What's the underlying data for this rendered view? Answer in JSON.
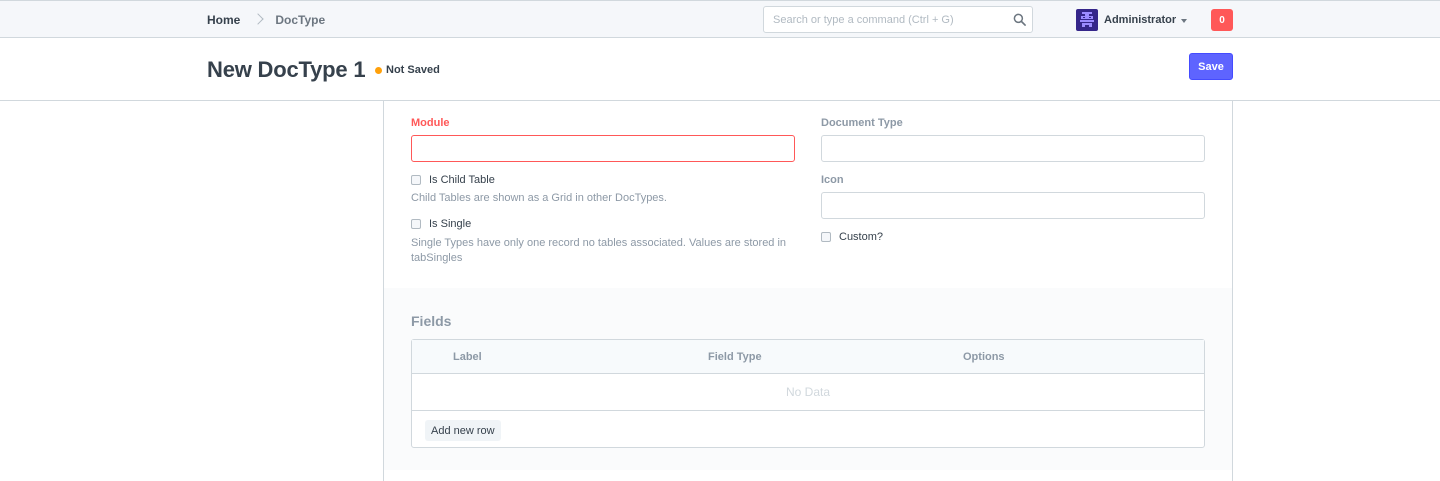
{
  "navbar": {
    "breadcrumbs": [
      "Home",
      "DocType"
    ],
    "search": {
      "placeholder": "Search or type a command (Ctrl + G)",
      "value": ""
    },
    "user": {
      "name": "Administrator"
    },
    "notification_count": "0"
  },
  "page": {
    "title": "New DocType 1",
    "status": "Not Saved",
    "save_label": "Save"
  },
  "form": {
    "module": {
      "label": "Module",
      "value": ""
    },
    "is_child_table": {
      "label": "Is Child Table",
      "help": "Child Tables are shown as a Grid in other DocTypes."
    },
    "is_single": {
      "label": "Is Single",
      "help": "Single Types have only one record no tables associated. Values are stored in tabSingles"
    },
    "document_type": {
      "label": "Document Type",
      "value": ""
    },
    "icon": {
      "label": "Icon",
      "value": ""
    },
    "custom": {
      "label": "Custom?"
    }
  },
  "fields_section": {
    "title": "Fields",
    "columns": [
      "Label",
      "Field Type",
      "Options"
    ],
    "empty_text": "No Data",
    "add_row_label": "Add new row"
  },
  "colors": {
    "primary": "#5e64ff",
    "danger": "#ff5858",
    "warning": "#ffa00a",
    "text": "#36414c",
    "muted": "#8d99a6",
    "border": "#d1d8dd"
  }
}
